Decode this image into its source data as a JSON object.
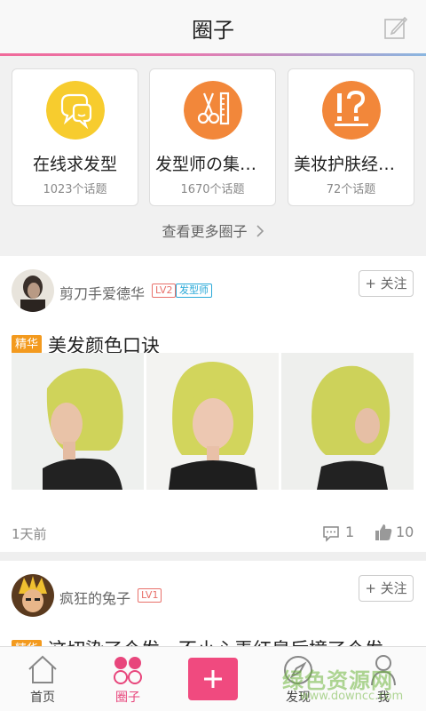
{
  "header": {
    "title": "圈子"
  },
  "circles": [
    {
      "name": "在线求发型",
      "count": "1023个话题",
      "icon": "chat-bubbles-icon",
      "color": "#f7cc2e"
    },
    {
      "name": "发型师の集结地",
      "count": "1670个话题",
      "icon": "scissors-ruler-icon",
      "color": "#f2873a"
    },
    {
      "name": "美妆护肤经验…",
      "count": "72个话题",
      "icon": "exclamation-question-icon",
      "color": "#f2873a"
    }
  ],
  "more_link": "查看更多圈子",
  "posts": [
    {
      "username": "剪刀手爱德华",
      "level": "LV2",
      "role": "发型师",
      "follow": "+ 关注",
      "tag": "精华",
      "title": "美发颜色口诀",
      "time": "1天前",
      "comments": "1",
      "likes": "10"
    },
    {
      "username": "疯狂的兔子",
      "level": "LV1",
      "follow": "+ 关注",
      "tag": "精华",
      "title": "这切染了个发，不小心弄红皇后撞了个发"
    }
  ],
  "nav": [
    {
      "label": "首页",
      "icon": "home-icon"
    },
    {
      "label": "圈子",
      "icon": "circles-icon"
    },
    {
      "label": "",
      "icon": "plus-icon"
    },
    {
      "label": "发现",
      "icon": "compass-icon"
    },
    {
      "label": "我",
      "icon": "person-icon"
    }
  ],
  "watermark": {
    "line1": "绿色资源网",
    "line2": "www.downcc.com"
  },
  "colors": {
    "accent": "#f04a7f",
    "tag": "#f39a1e",
    "role_badge": "#2aa9d8",
    "level_badge": "#e8706a"
  }
}
